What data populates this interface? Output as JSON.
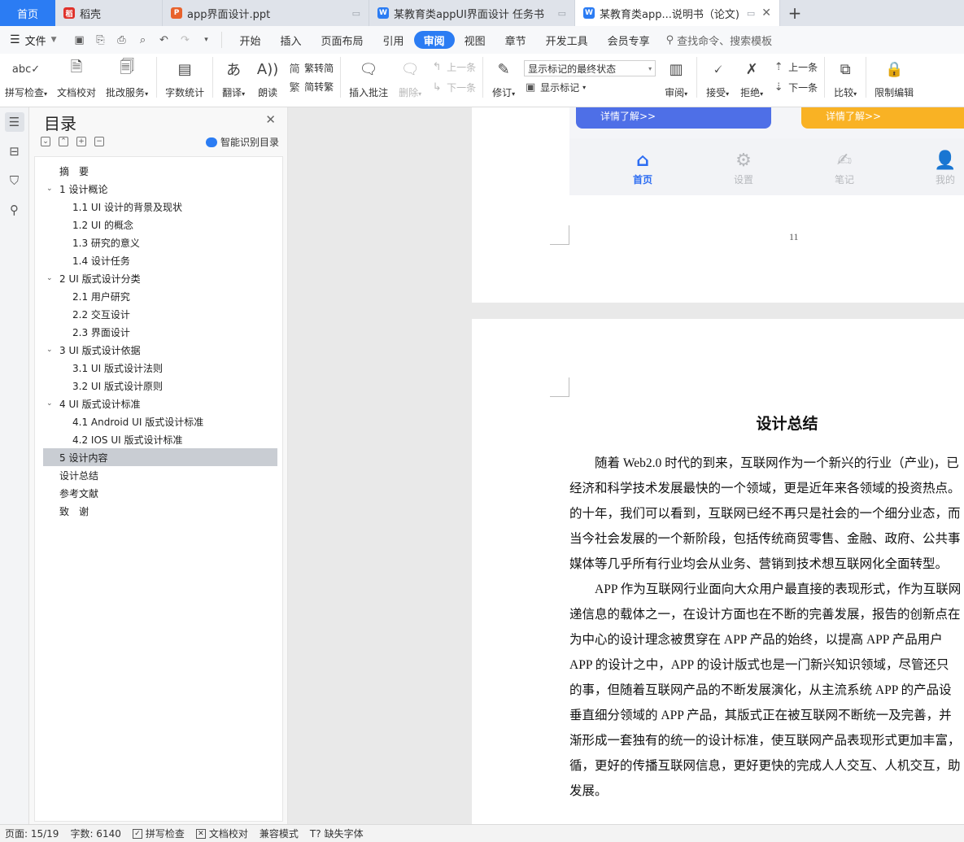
{
  "tabs": [
    {
      "label": "首页",
      "kind": "home"
    },
    {
      "label": "稻壳",
      "kind": "docer",
      "icon_color": "#e0322b"
    },
    {
      "label": "app界面设计.ppt",
      "kind": "ppt",
      "icon_color": "#e8622c"
    },
    {
      "label": "某教育类appUI界面设计 任务书",
      "kind": "doc",
      "icon_color": "#2b7cf3"
    },
    {
      "label": "某教育类app...说明书（论文)",
      "kind": "doc",
      "icon_color": "#2b7cf3",
      "active": true
    }
  ],
  "menubar": {
    "file_label": "文件",
    "items": [
      "开始",
      "插入",
      "页面布局",
      "引用",
      "审阅",
      "视图",
      "章节",
      "开发工具",
      "会员专享"
    ],
    "active_item": "审阅",
    "search_label": "查找命令、搜索模板"
  },
  "ribbon": {
    "spell_check": "拼写检查",
    "doc_proof": "文档校对",
    "correct_service": "批改服务",
    "word_count": "字数统计",
    "translate": "翻译",
    "read_aloud": "朗读",
    "trad_to_simp": "繁转简",
    "simp_to_trad": "简转繁",
    "insert_comment": "插入批注",
    "delete": "删除",
    "prev_item": "上一条",
    "next_item": "下一条",
    "track_changes": "修订",
    "markup_state": "显示标记的最终状态",
    "show_markup": "显示标记",
    "review": "审阅",
    "accept": "接受",
    "reject": "拒绝",
    "prev_change": "上一条",
    "next_change": "下一条",
    "compare": "比较",
    "restrict_edit": "限制编辑"
  },
  "outline": {
    "title": "目录",
    "smart_label": "智能识别目录",
    "items": [
      {
        "text": "摘　要",
        "level": 0
      },
      {
        "text": "1  设计概论",
        "level": 1
      },
      {
        "text": "1.1 UI 设计的背景及现状",
        "level": 2
      },
      {
        "text": "1.2 UI 的概念",
        "level": 2
      },
      {
        "text": "1.3 研究的意义",
        "level": 2
      },
      {
        "text": "1.4 设计任务",
        "level": 2
      },
      {
        "text": "2 UI 版式设计分类",
        "level": 1
      },
      {
        "text": "2.1 用户研究",
        "level": 2
      },
      {
        "text": "2.2  交互设计",
        "level": 2
      },
      {
        "text": "2.3  界面设计",
        "level": 2
      },
      {
        "text": "3 UI 版式设计依据",
        "level": 1
      },
      {
        "text": "3.1 UI 版式设计法则",
        "level": 2
      },
      {
        "text": "3.2 UI 版式设计原则",
        "level": 2
      },
      {
        "text": "4 UI 版式设计标准",
        "level": 1
      },
      {
        "text": "4.1 Android UI 版式设计标准",
        "level": 2
      },
      {
        "text": "4.2 IOS UI 版式设计标准",
        "level": 2
      },
      {
        "text": "5  设计内容",
        "level": 0,
        "selected": true
      },
      {
        "text": "设计总结",
        "level": 0
      },
      {
        "text": "参考文献",
        "level": 0
      },
      {
        "text": "致　谢",
        "level": 0
      }
    ]
  },
  "mockup": {
    "btn_more_1": "详情了解>>",
    "btn_more_2": "详情了解>>",
    "nav": [
      {
        "label": "首页",
        "icon": "home-icon",
        "active": true
      },
      {
        "label": "设置",
        "icon": "gear-icon"
      },
      {
        "label": "笔记",
        "icon": "note-icon"
      },
      {
        "label": "我的",
        "icon": "user-icon"
      }
    ],
    "brand_color": "#2c6cf2"
  },
  "page1": {
    "page_number": "11"
  },
  "page2": {
    "title": "设计总结",
    "lines": [
      {
        "text": "随着 Web2.0 时代的到来，互联网作为一个新兴的行业（产业)，已",
        "indent": true
      },
      {
        "text": "经济和科学技术发展最快的一个领域，更是近年来各领域的投资热点。",
        "indent": false
      },
      {
        "text": "的十年，我们可以看到，互联网已经不再只是社会的一个细分业态，而",
        "indent": false
      },
      {
        "text": "当今社会发展的一个新阶段，包括传统商贸零售、金融、政府、公共事",
        "indent": false
      },
      {
        "text": "媒体等几乎所有行业均会从业务、营销到技术想互联网化全面转型。",
        "indent": false
      },
      {
        "text": "APP 作为互联网行业面向大众用户最直接的表现形式，作为互联网",
        "indent": true
      },
      {
        "text": "递信息的载体之一，在设计方面也在不断的完善发展，报告的创新点在",
        "indent": false
      },
      {
        "text": "为中心的设计理念被贯穿在 APP 产品的始终，以提高 APP 产品用户",
        "indent": false
      },
      {
        "text": "APP 的设计之中，APP 的设计版式也是一门新兴知识领域，尽管还只",
        "indent": false
      },
      {
        "text": "的事，但随着互联网产品的不断发展演化，从主流系统 APP 的产品设",
        "indent": false
      },
      {
        "text": "垂直细分领域的 APP 产品，其版式正在被互联网不断统一及完善，并",
        "indent": false
      },
      {
        "text": "渐形成一套独有的统一的设计标准，使互联网产品表现形式更加丰富，",
        "indent": false
      },
      {
        "text": "循，更好的传播互联网信息，更好更快的完成人人交互、人机交互，助",
        "indent": false
      },
      {
        "text": "发展。",
        "indent": false
      }
    ]
  },
  "statusbar": {
    "page": "页面: 15/19",
    "words": "字数: 6140",
    "spell_check": "拼写检查",
    "doc_proof": "文档校对",
    "compat_mode": "兼容模式",
    "missing_font": "缺失字体"
  }
}
